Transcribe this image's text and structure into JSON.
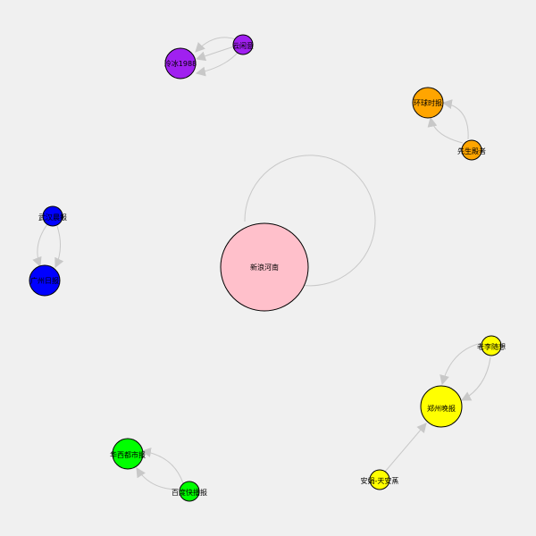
{
  "graph": {
    "background": "#f0f0f0",
    "edge_color": "#c8c8c8",
    "nodes": [
      {
        "id": "xinlang",
        "label": "新浪河南",
        "color": "#ffc0cb",
        "size": "large"
      },
      {
        "id": "lengbing",
        "label": "冷冰1988",
        "color": "#a020f0",
        "size": "medium"
      },
      {
        "id": "yunxian",
        "label": "云闲意",
        "color": "#a020f0",
        "size": "small"
      },
      {
        "id": "huanqiu",
        "label": "环球时报",
        "color": "#ffa500",
        "size": "medium"
      },
      {
        "id": "xiansheng",
        "label": "先生殿者",
        "color": "#ffa500",
        "size": "small"
      },
      {
        "id": "wuhan",
        "label": "武汉晨报",
        "color": "#0000ff",
        "size": "small"
      },
      {
        "id": "guangzhou",
        "label": "广州日报",
        "color": "#0000ff",
        "size": "medium"
      },
      {
        "id": "zhengzhou",
        "label": "郑州晚报",
        "color": "#ffff00",
        "size": "large-ish"
      },
      {
        "id": "laoli",
        "label": "老李随想",
        "color": "#ffff00",
        "size": "small"
      },
      {
        "id": "anjia",
        "label": "安娟-天安蒸",
        "color": "#ffff00",
        "size": "small"
      },
      {
        "id": "huaxi",
        "label": "华西都市报",
        "color": "#00ff00",
        "size": "medium"
      },
      {
        "id": "baidu",
        "label": "百度快播报",
        "color": "#00ff00",
        "size": "small"
      }
    ],
    "edges": [
      {
        "from": "xinlang",
        "to": "xinlang",
        "type": "self-loop"
      },
      {
        "from": "yunxian",
        "to": "lengbing"
      },
      {
        "from": "yunxian",
        "to": "lengbing"
      },
      {
        "from": "yunxian",
        "to": "lengbing"
      },
      {
        "from": "xiansheng",
        "to": "huanqiu"
      },
      {
        "from": "xiansheng",
        "to": "huanqiu"
      },
      {
        "from": "wuhan",
        "to": "guangzhou"
      },
      {
        "from": "wuhan",
        "to": "guangzhou"
      },
      {
        "from": "laoli",
        "to": "zhengzhou"
      },
      {
        "from": "laoli",
        "to": "zhengzhou"
      },
      {
        "from": "anjia",
        "to": "zhengzhou"
      },
      {
        "from": "baidu",
        "to": "huaxi"
      },
      {
        "from": "baidu",
        "to": "huaxi"
      }
    ]
  }
}
